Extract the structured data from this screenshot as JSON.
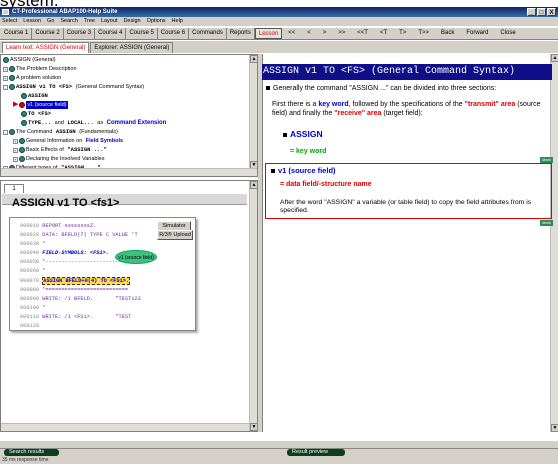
{
  "page_heading": "system.",
  "window": {
    "title": "CT-Professional ABAP100-Help Suite",
    "min": "_",
    "max": "□",
    "close": "X"
  },
  "menu": [
    "Select",
    "Lesson",
    "Go",
    "Search",
    "Tree",
    "Layout",
    "Design",
    "Options",
    "Help"
  ],
  "toolbar": {
    "courses": [
      "Course 1",
      "Course 2",
      "Course 3",
      "Course 4",
      "Course 5",
      "Course 6",
      "Commands",
      "Reports"
    ],
    "lesson": "Lesson",
    "nav": [
      "<<",
      "<",
      ">",
      ">>",
      "<<T",
      "<T",
      "T>",
      "T>>",
      "Back",
      "Forward",
      "Close"
    ]
  },
  "tabs": [
    "Learn text: ASSIGN (General)",
    "Explorer: ASSIGN (General)"
  ],
  "tree": {
    "root": "ASSIGN (General)",
    "n1": "The Problem Description",
    "n2": "A problem solution",
    "n3a": "ASSIGN v1 TO <FS>",
    "n3b": "(General Command Syntax)",
    "n3_c1": "ASSIGN",
    "n3_c2": "v1 (source field)",
    "n3_c3": "TO <FS>",
    "n3_c4a": "TYPE...",
    "n3_c4b": "and",
    "n3_c4c": "LOCAL...",
    "n3_c4d": "as",
    "n3_c4e": "Command Extension",
    "n4a": "The Command",
    "n4b": "ASSIGN",
    "n4c": "(Fundamentals)",
    "n4_c1a": "General Information on",
    "n4_c1b": "Field Symbols",
    "n4_c2a": "Basic Effects of",
    "n4_c2b": "\"ASSIGN ...\"",
    "n4_c3": "Declaring the Involved Variables",
    "n5a": "Different types of",
    "n5b": "\"ASSIGN ...\""
  },
  "left": {
    "tab": "1",
    "title": "ASSIGN v1 TO <fs1>",
    "simulator": "Simulator",
    "upload": "R/3® Upload",
    "callout": "v1 (source field)",
    "code": [
      {
        "ln": "000010",
        "code": "REPORT ssssssssZ."
      },
      {
        "ln": "000020",
        "code": "DATA: BFELD(7) TYPE C VALUE 'T"
      },
      {
        "ln": "000030",
        "code": "*"
      },
      {
        "ln": "000040",
        "code": "FIELD-SYMBOLS: <FS1>."
      },
      {
        "ln": "000050",
        "code": "*-------------------------"
      },
      {
        "ln": "000060",
        "code": "*"
      },
      {
        "ln": "000070",
        "code": "ASSIGN BFELD+0(4) TO <FS1>."
      },
      {
        "ln": "000080",
        "code": "*=========================="
      },
      {
        "ln": "000090",
        "code": "WRITE: /1 BFELD.       \"TEST123"
      },
      {
        "ln": "000100",
        "code": "*"
      },
      {
        "ln": "000110",
        "code": "WRITE: /1 <FS1>.       \"TEST"
      },
      {
        "ln": "000120",
        "code": ""
      }
    ]
  },
  "right": {
    "heading": "ASSIGN v1 TO <FS> (General Command Syntax)",
    "intro": "Generally the command \"ASSIGN ...\" can be divided into three sections:",
    "p1_a": "First there is a",
    "p1_kw": "key word",
    "p1_b": ", followed by the specifications of the",
    "p1_transmit": "\"transmit\"",
    "p1_area1": "area",
    "p1_c": "(source field) and finally the",
    "p1_receive": "\"receive\"",
    "p1_area2": "area",
    "p1_d": "(target field):",
    "assign_label": "ASSIGN",
    "assign_def": "= key word",
    "mark": "Mark",
    "v1_label": "v1 (source field)",
    "v1_def": "= data field/-structure name",
    "p2": "After the word \"ASSIGN\" a variable (or table field) to copy the field attributes from is specified."
  },
  "bottom": {
    "search": "Search results",
    "preview": "Result preview",
    "status": "35 ms response time"
  }
}
